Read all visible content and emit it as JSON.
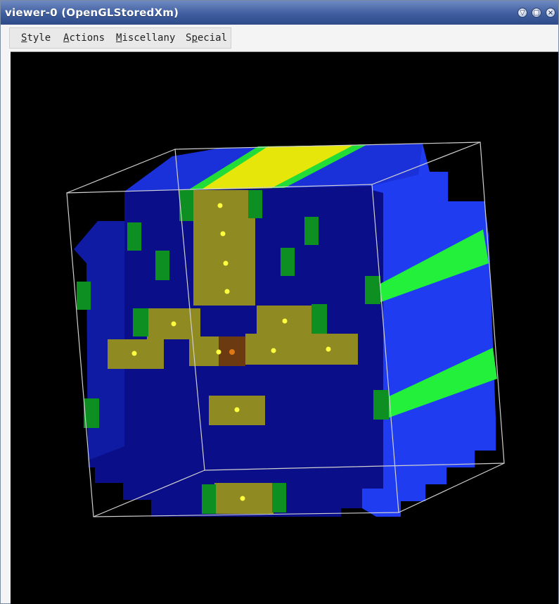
{
  "window": {
    "title": "viewer-0 (OpenGLStoredXm)",
    "controls": {
      "minimize": "▽",
      "maximize": "□",
      "close": "×"
    }
  },
  "menu": {
    "items": [
      {
        "label": "Style"
      },
      {
        "label": "Actions"
      },
      {
        "label": "Miscellany"
      },
      {
        "label": "Special"
      }
    ]
  },
  "scene": {
    "description_colors": {
      "background": "#000000",
      "dark_blue": "#0a0e8c",
      "blue": "#1a2ee6",
      "bright_blue": "#1f44ff",
      "green": "#22f03a",
      "dark_green": "#0d8f22",
      "olive": "#8f8a22",
      "yellow": "#e6e60a",
      "brown": "#6b3a10",
      "dot": "#ffff40",
      "box_edge": "#d9d9d9"
    }
  }
}
